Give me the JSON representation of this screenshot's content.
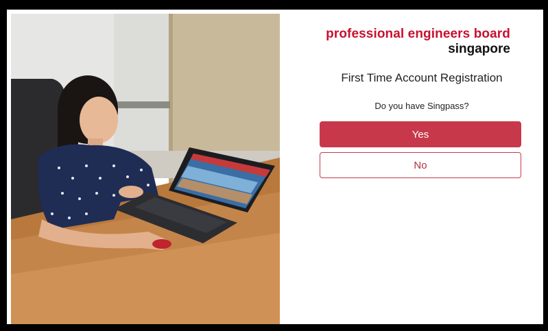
{
  "brand": {
    "line1": "professional engineers board",
    "line2": "singapore",
    "accent_color": "#c8102e"
  },
  "registration": {
    "title": "First Time Account Registration",
    "question": "Do you have Singpass?",
    "yes_label": "Yes",
    "no_label": "No",
    "button_color": "#c7394a"
  }
}
